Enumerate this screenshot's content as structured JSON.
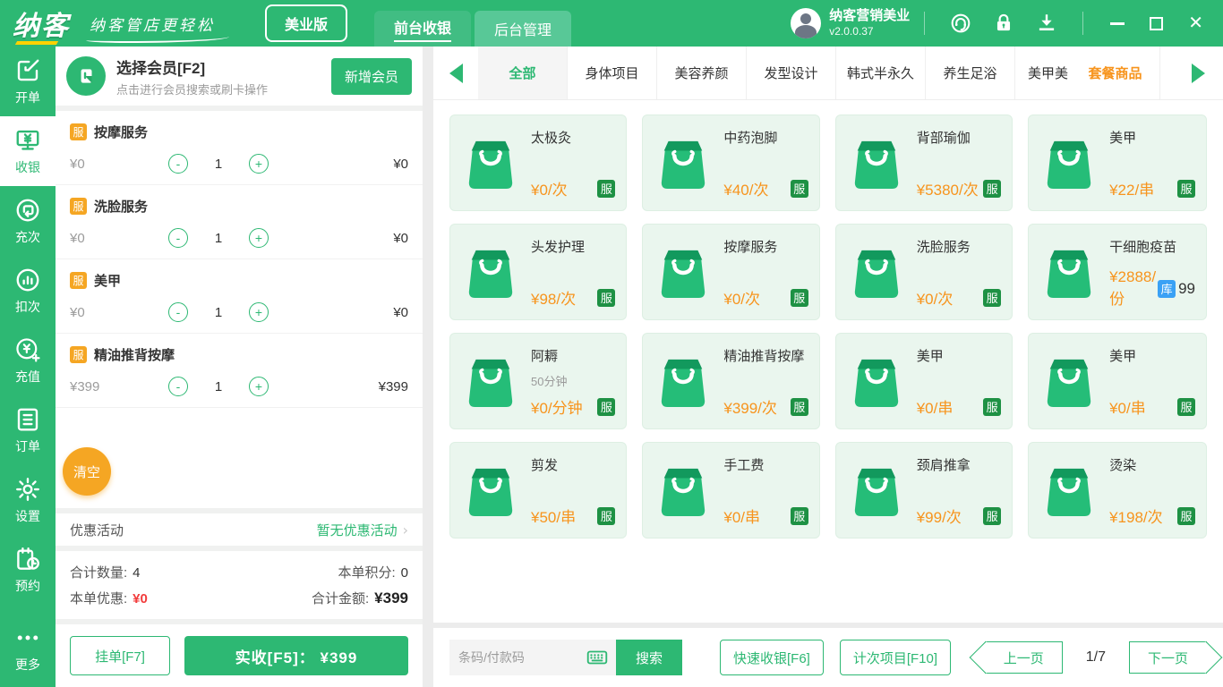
{
  "theme": {
    "green": "#2db873",
    "dark_badge_green": "#1e9144",
    "orange": "#f5a623",
    "price_orange": "#f7941d",
    "stock_blue": "#3aa1f5",
    "red": "#f23c3c",
    "card_bg": "#eaf6ee"
  },
  "header": {
    "logo": "纳客",
    "slogan": "纳客管店更轻松",
    "edition": "美业版",
    "tabs": [
      {
        "id": "front-cashier",
        "label": "前台收银",
        "active": true
      },
      {
        "id": "back-admin",
        "label": "后台管理",
        "active": false
      }
    ],
    "user": {
      "name": "纳客营销美业",
      "version": "v2.0.0.37"
    },
    "icons": [
      "headset-support",
      "lock",
      "download",
      "minimize",
      "maximize",
      "close"
    ]
  },
  "sidebar": {
    "items": [
      {
        "id": "open-order",
        "label": "开单",
        "icon": "order-edit",
        "active": false
      },
      {
        "id": "cashier",
        "label": "收银",
        "icon": "cashier-monitor",
        "active": true
      },
      {
        "id": "recharge-times",
        "label": "充次",
        "icon": "recharge-times",
        "active": false
      },
      {
        "id": "deduct-times",
        "label": "扣次",
        "icon": "deduct-times",
        "active": false
      },
      {
        "id": "recharge-value",
        "label": "充值",
        "icon": "recharge-money",
        "active": false
      },
      {
        "id": "orders",
        "label": "订单",
        "icon": "orders-list",
        "active": false
      },
      {
        "id": "settings",
        "label": "设置",
        "icon": "settings-gear",
        "active": false
      },
      {
        "id": "booking",
        "label": "预约",
        "icon": "booking-clock",
        "active": false
      },
      {
        "id": "more",
        "label": "更多",
        "icon": "more-dots",
        "active": false,
        "bottom": true
      }
    ]
  },
  "cart": {
    "member": {
      "title": "选择会员[F2]",
      "subtitle": "点击进行会员搜索或刷卡操作",
      "add_button": "新增会员"
    },
    "items": [
      {
        "badge": "服",
        "name": "按摩服务",
        "price": "¥0",
        "qty": "1",
        "amount": "¥0"
      },
      {
        "badge": "服",
        "name": "洗脸服务",
        "price": "¥0",
        "qty": "1",
        "amount": "¥0"
      },
      {
        "badge": "服",
        "name": "美甲",
        "price": "¥0",
        "qty": "1",
        "amount": "¥0"
      },
      {
        "badge": "服",
        "name": "精油推背按摩",
        "price": "¥399",
        "qty": "1",
        "amount": "¥399"
      }
    ],
    "clear_button": "清空",
    "promo": {
      "label": "优惠活动",
      "value": "暂无优惠活动",
      "chevron": "›"
    },
    "summary": {
      "qty_label": "合计数量:",
      "qty": "4",
      "points_label": "本单积分:",
      "points": "0",
      "discount_label": "本单优惠:",
      "discount": "¥0",
      "total_label": "合计金额:",
      "total": "¥399"
    },
    "hold_button": "挂单[F7]",
    "pay_button": "实收[F5]：  ¥399"
  },
  "catalog": {
    "categories": [
      {
        "label": "全部",
        "active": true
      },
      {
        "label": "身体项目"
      },
      {
        "label": "美容养颜"
      },
      {
        "label": "发型设计"
      },
      {
        "label": "韩式半永久"
      },
      {
        "label": "养生足浴"
      },
      {
        "label": "美甲美",
        "truncated": true
      },
      {
        "label": "套餐商品",
        "highlight": true
      }
    ],
    "products": [
      {
        "name": "太极灸",
        "price": "¥0/次",
        "badge": "服",
        "badge_type": "service"
      },
      {
        "name": "中药泡脚",
        "price": "¥40/次",
        "badge": "服",
        "badge_type": "service"
      },
      {
        "name": "背部瑜伽",
        "price": "¥5380/次",
        "badge": "服",
        "badge_type": "service"
      },
      {
        "name": "美甲",
        "price": "¥22/串",
        "badge": "服",
        "badge_type": "service"
      },
      {
        "name": "头发护理",
        "price": "¥98/次",
        "badge": "服",
        "badge_type": "service"
      },
      {
        "name": "按摩服务",
        "price": "¥0/次",
        "badge": "服",
        "badge_type": "service"
      },
      {
        "name": "洗脸服务",
        "price": "¥0/次",
        "badge": "服",
        "badge_type": "service"
      },
      {
        "name": "干细胞疫苗",
        "price": "¥2888/份",
        "badge": "库",
        "badge_type": "stock",
        "stock": "99"
      },
      {
        "name": "阿耨",
        "note": "50分钟",
        "price": "¥0/分钟",
        "badge": "服",
        "badge_type": "service"
      },
      {
        "name": "精油推背按摩",
        "price": "¥399/次",
        "badge": "服",
        "badge_type": "service"
      },
      {
        "name": "美甲",
        "price": "¥0/串",
        "badge": "服",
        "badge_type": "service"
      },
      {
        "name": "美甲",
        "price": "¥0/串",
        "badge": "服",
        "badge_type": "service"
      },
      {
        "name": "剪发",
        "price": "¥50/串",
        "badge": "服",
        "badge_type": "service"
      },
      {
        "name": "手工费",
        "price": "¥0/串",
        "badge": "服",
        "badge_type": "service"
      },
      {
        "name": "颈肩推拿",
        "price": "¥99/次",
        "badge": "服",
        "badge_type": "service"
      },
      {
        "name": "烫染",
        "price": "¥198/次",
        "badge": "服",
        "badge_type": "service"
      }
    ],
    "footer": {
      "search_placeholder": "条码/付款码",
      "search_button": "搜索",
      "quick_pay_button": "快速收银[F6]",
      "count_item_button": "计次项目[F10]",
      "prev_page": "上一页",
      "page_indicator": "1/7",
      "next_page": "下一页"
    }
  }
}
